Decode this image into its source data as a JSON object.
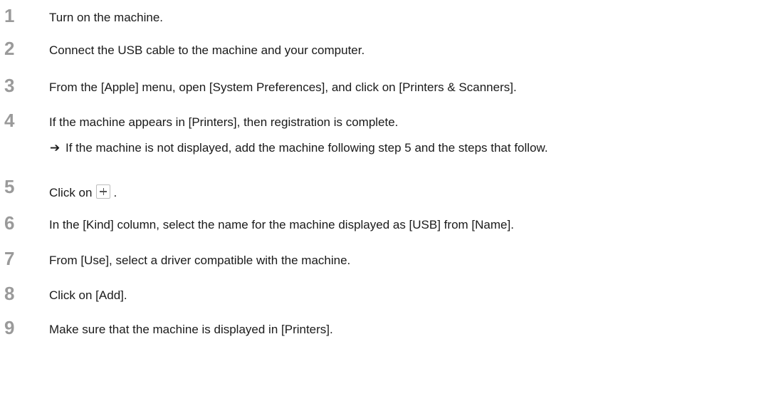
{
  "steps": [
    {
      "num": "1",
      "text": "Turn on the machine."
    },
    {
      "num": "2",
      "text": "Connect the USB cable to the machine and your computer."
    },
    {
      "num": "3",
      "text": "From the [Apple] menu, open [System Preferences], and click on [Printers & Scanners]."
    },
    {
      "num": "4",
      "text": "If the machine appears in [Printers], then registration is complete.",
      "sub_arrow": "➔",
      "sub_text": "If the machine is not displayed, add the machine following step 5 and the steps that follow."
    },
    {
      "num": "5",
      "text_before": "Click on",
      "text_after": ".",
      "icon": "plus-icon"
    },
    {
      "num": "6",
      "text": "In the [Kind] column, select the name for the machine displayed as [USB] from [Name]."
    },
    {
      "num": "7",
      "text": "From [Use], select a driver compatible with the machine."
    },
    {
      "num": "8",
      "text": "Click on [Add]."
    },
    {
      "num": "9",
      "text": "Make sure that the machine is displayed in [Printers]."
    }
  ]
}
